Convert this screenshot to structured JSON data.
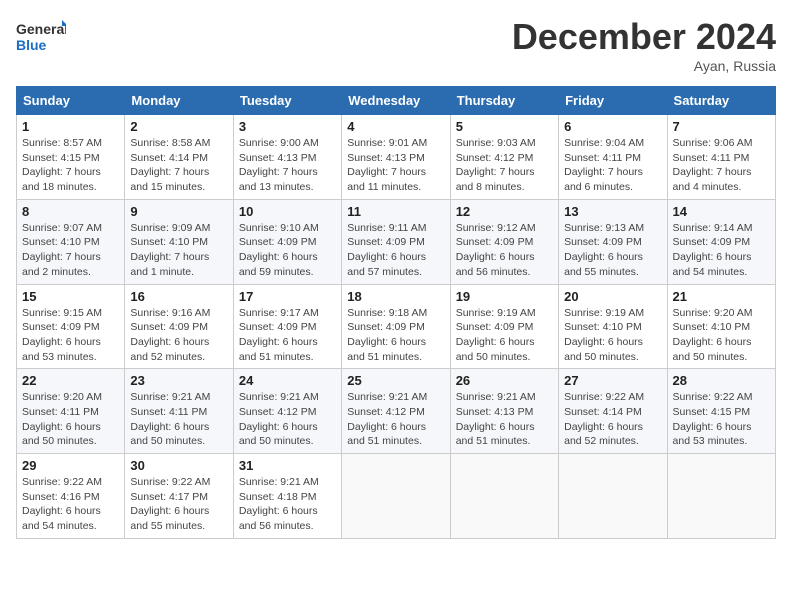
{
  "logo": {
    "line1": "General",
    "line2": "Blue"
  },
  "title": "December 2024",
  "location": "Ayan, Russia",
  "headers": [
    "Sunday",
    "Monday",
    "Tuesday",
    "Wednesday",
    "Thursday",
    "Friday",
    "Saturday"
  ],
  "weeks": [
    [
      {
        "day": "1",
        "detail": "Sunrise: 8:57 AM\nSunset: 4:15 PM\nDaylight: 7 hours\nand 18 minutes."
      },
      {
        "day": "2",
        "detail": "Sunrise: 8:58 AM\nSunset: 4:14 PM\nDaylight: 7 hours\nand 15 minutes."
      },
      {
        "day": "3",
        "detail": "Sunrise: 9:00 AM\nSunset: 4:13 PM\nDaylight: 7 hours\nand 13 minutes."
      },
      {
        "day": "4",
        "detail": "Sunrise: 9:01 AM\nSunset: 4:13 PM\nDaylight: 7 hours\nand 11 minutes."
      },
      {
        "day": "5",
        "detail": "Sunrise: 9:03 AM\nSunset: 4:12 PM\nDaylight: 7 hours\nand 8 minutes."
      },
      {
        "day": "6",
        "detail": "Sunrise: 9:04 AM\nSunset: 4:11 PM\nDaylight: 7 hours\nand 6 minutes."
      },
      {
        "day": "7",
        "detail": "Sunrise: 9:06 AM\nSunset: 4:11 PM\nDaylight: 7 hours\nand 4 minutes."
      }
    ],
    [
      {
        "day": "8",
        "detail": "Sunrise: 9:07 AM\nSunset: 4:10 PM\nDaylight: 7 hours\nand 2 minutes."
      },
      {
        "day": "9",
        "detail": "Sunrise: 9:09 AM\nSunset: 4:10 PM\nDaylight: 7 hours\nand 1 minute."
      },
      {
        "day": "10",
        "detail": "Sunrise: 9:10 AM\nSunset: 4:09 PM\nDaylight: 6 hours\nand 59 minutes."
      },
      {
        "day": "11",
        "detail": "Sunrise: 9:11 AM\nSunset: 4:09 PM\nDaylight: 6 hours\nand 57 minutes."
      },
      {
        "day": "12",
        "detail": "Sunrise: 9:12 AM\nSunset: 4:09 PM\nDaylight: 6 hours\nand 56 minutes."
      },
      {
        "day": "13",
        "detail": "Sunrise: 9:13 AM\nSunset: 4:09 PM\nDaylight: 6 hours\nand 55 minutes."
      },
      {
        "day": "14",
        "detail": "Sunrise: 9:14 AM\nSunset: 4:09 PM\nDaylight: 6 hours\nand 54 minutes."
      }
    ],
    [
      {
        "day": "15",
        "detail": "Sunrise: 9:15 AM\nSunset: 4:09 PM\nDaylight: 6 hours\nand 53 minutes."
      },
      {
        "day": "16",
        "detail": "Sunrise: 9:16 AM\nSunset: 4:09 PM\nDaylight: 6 hours\nand 52 minutes."
      },
      {
        "day": "17",
        "detail": "Sunrise: 9:17 AM\nSunset: 4:09 PM\nDaylight: 6 hours\nand 51 minutes."
      },
      {
        "day": "18",
        "detail": "Sunrise: 9:18 AM\nSunset: 4:09 PM\nDaylight: 6 hours\nand 51 minutes."
      },
      {
        "day": "19",
        "detail": "Sunrise: 9:19 AM\nSunset: 4:09 PM\nDaylight: 6 hours\nand 50 minutes."
      },
      {
        "day": "20",
        "detail": "Sunrise: 9:19 AM\nSunset: 4:10 PM\nDaylight: 6 hours\nand 50 minutes."
      },
      {
        "day": "21",
        "detail": "Sunrise: 9:20 AM\nSunset: 4:10 PM\nDaylight: 6 hours\nand 50 minutes."
      }
    ],
    [
      {
        "day": "22",
        "detail": "Sunrise: 9:20 AM\nSunset: 4:11 PM\nDaylight: 6 hours\nand 50 minutes."
      },
      {
        "day": "23",
        "detail": "Sunrise: 9:21 AM\nSunset: 4:11 PM\nDaylight: 6 hours\nand 50 minutes."
      },
      {
        "day": "24",
        "detail": "Sunrise: 9:21 AM\nSunset: 4:12 PM\nDaylight: 6 hours\nand 50 minutes."
      },
      {
        "day": "25",
        "detail": "Sunrise: 9:21 AM\nSunset: 4:12 PM\nDaylight: 6 hours\nand 51 minutes."
      },
      {
        "day": "26",
        "detail": "Sunrise: 9:21 AM\nSunset: 4:13 PM\nDaylight: 6 hours\nand 51 minutes."
      },
      {
        "day": "27",
        "detail": "Sunrise: 9:22 AM\nSunset: 4:14 PM\nDaylight: 6 hours\nand 52 minutes."
      },
      {
        "day": "28",
        "detail": "Sunrise: 9:22 AM\nSunset: 4:15 PM\nDaylight: 6 hours\nand 53 minutes."
      }
    ],
    [
      {
        "day": "29",
        "detail": "Sunrise: 9:22 AM\nSunset: 4:16 PM\nDaylight: 6 hours\nand 54 minutes."
      },
      {
        "day": "30",
        "detail": "Sunrise: 9:22 AM\nSunset: 4:17 PM\nDaylight: 6 hours\nand 55 minutes."
      },
      {
        "day": "31",
        "detail": "Sunrise: 9:21 AM\nSunset: 4:18 PM\nDaylight: 6 hours\nand 56 minutes."
      },
      null,
      null,
      null,
      null
    ]
  ]
}
